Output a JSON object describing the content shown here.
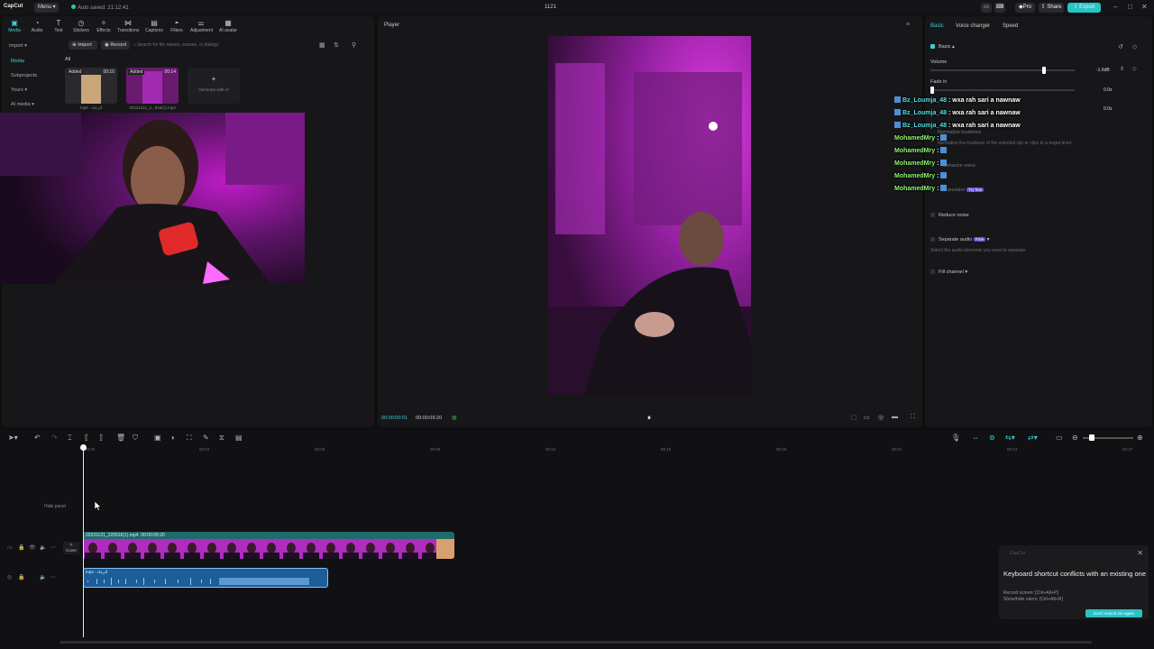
{
  "titlebar": {
    "logo": "CapCut",
    "menu_label": "Menu",
    "autosave": "Auto saved: 21:12:41",
    "project_name": "1121",
    "pro_label": "Pro",
    "share_label": "Share",
    "export_label": "Export"
  },
  "toolbar": {
    "items": [
      {
        "label": "Media",
        "icon": "media-icon"
      },
      {
        "label": "Audio",
        "icon": "audio-icon"
      },
      {
        "label": "Text",
        "icon": "text-icon"
      },
      {
        "label": "Stickers",
        "icon": "stickers-icon"
      },
      {
        "label": "Effects",
        "icon": "effects-icon"
      },
      {
        "label": "Transitions",
        "icon": "transitions-icon"
      },
      {
        "label": "Captions",
        "icon": "captions-icon"
      },
      {
        "label": "Filters",
        "icon": "filters-icon"
      },
      {
        "label": "Adjustment",
        "icon": "adjustment-icon"
      },
      {
        "label": "AI avatar",
        "icon": "ai-avatar-icon"
      }
    ]
  },
  "media_sidebar": {
    "items": [
      "Import",
      "Media",
      "Subprojects",
      "Yours",
      "AI media"
    ]
  },
  "media": {
    "import_label": "Import",
    "record_label": "Record",
    "search_placeholder": "Search for file names, scenes, or dialogs",
    "filter_all": "All",
    "thumbs": [
      {
        "added": "Added",
        "duration": "00:10",
        "name": "mp4 - الرجاء"
      },
      {
        "added": "Added",
        "duration": "00:14",
        "name": "20231121_2...916(1).mp4"
      }
    ],
    "generate_label": "Generate with AI"
  },
  "player": {
    "title": "Player",
    "current_time": "00:00:00:01",
    "total_time": "00:00:09:20"
  },
  "details": {
    "tabs": [
      "Basic",
      "Voice changer",
      "Speed"
    ],
    "basic_label": "Basic",
    "volume_label": "Volume",
    "volume_value": "-1.6dB",
    "fadein_label": "Fade in",
    "fadein_value": "0.0s",
    "fadeout_value": "0.0s",
    "normalize_label": "Normalize loudness",
    "normalize_desc": "Normalize the loudness of the selected clip or clips to a target level.",
    "enhance_label": "Enhance voice",
    "translator_label": "Translator",
    "try_free": "Try free",
    "reduce_noise_label": "Reduce noise",
    "separate_label": "Separate audio",
    "separate_badge": "Free",
    "separate_desc": "Select the audio elements you want to separate.",
    "fill_channel_label": "Fill channel"
  },
  "chat": [
    {
      "user": "Bz_Loumja_48",
      "msg": ": wxa rah sari a nawnaw",
      "type": "a"
    },
    {
      "user": "Bz_Loumja_48",
      "msg": ": wxa rah sari a nawnaw",
      "type": "a"
    },
    {
      "user": "Bz_Loumja_48",
      "msg": ": wxa rah sari a nawnaw",
      "type": "a"
    },
    {
      "user": "MohamedMry",
      "msg": ":",
      "type": "b"
    },
    {
      "user": "MohamedMry",
      "msg": ":",
      "type": "b"
    },
    {
      "user": "MohamedMry",
      "msg": ":",
      "type": "b"
    },
    {
      "user": "MohamedMry",
      "msg": ":",
      "type": "b"
    },
    {
      "user": "MohamedMry",
      "msg": ":",
      "type": "b"
    }
  ],
  "timeline": {
    "ruler": [
      "00:00",
      "00:03",
      "00:06",
      "00:09",
      "00:12",
      "00:15",
      "00:18",
      "00:21",
      "00:24",
      "00:27"
    ],
    "video_clip_name": "20231121_220916(1).mp4",
    "video_clip_duration": "00:00:09:20",
    "audio_clip_name": "mp4 - الرجاء",
    "cover_label": "Cover",
    "hide_panel": "Hide panel"
  },
  "toast": {
    "app": "CapCut",
    "title": "Keyboard shortcut conflicts with an existing one",
    "line1": "Record screen: [Ctrl+Alt+P]",
    "line2": "Show/hide rulers: [Ctrl+Alt+R]",
    "remind": "Don't remind me again"
  }
}
